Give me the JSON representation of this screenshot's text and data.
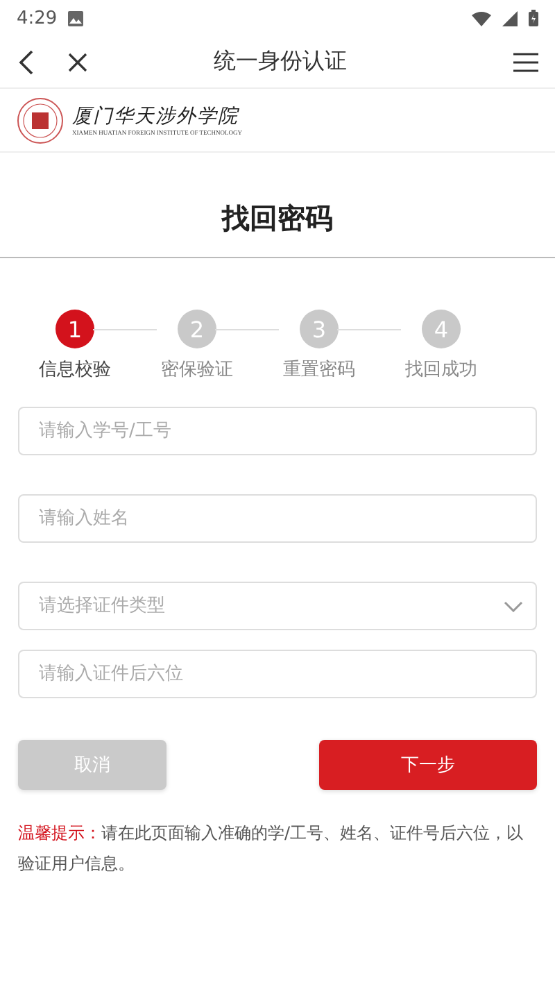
{
  "status_bar": {
    "time": "4:29"
  },
  "nav": {
    "title": "统一身份认证"
  },
  "logo": {
    "name": "厦门华天涉外学院",
    "subtitle": "XIAMEN HUATIAN FOREIGN INSTITUTE OF TECHNOLOGY"
  },
  "page_title": "找回密码",
  "steps": [
    {
      "number": "1",
      "label": "信息校验",
      "selected": true
    },
    {
      "number": "2",
      "label": "密保验证",
      "selected": false
    },
    {
      "number": "3",
      "label": "重置密码",
      "selected": false
    },
    {
      "number": "4",
      "label": "找回成功",
      "selected": false
    }
  ],
  "fields": [
    {
      "kind": "text",
      "placeholder": "请输入学号/工号"
    },
    {
      "kind": "text",
      "placeholder": "请输入姓名"
    },
    {
      "kind": "select",
      "placeholder": "请选择证件类型"
    },
    {
      "kind": "text",
      "placeholder": "请输入证件后六位"
    }
  ],
  "buttons": {
    "cancel": "取消",
    "next": "下一步"
  },
  "tip": {
    "label": "温馨提示：",
    "text": "请在此页面输入准确的学/工号、姓名、证件号后六位，以验证用户信息。"
  }
}
